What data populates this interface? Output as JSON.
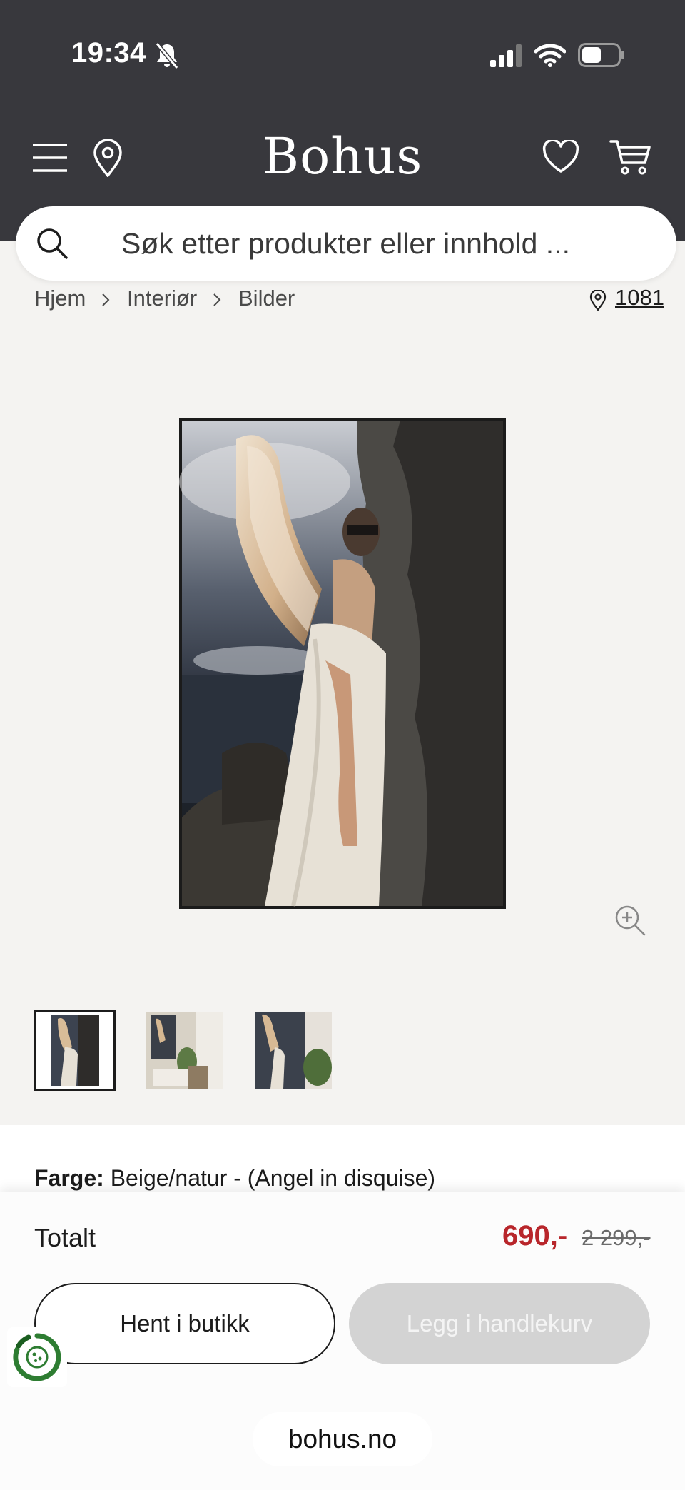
{
  "status_bar": {
    "time": "19:34"
  },
  "header": {
    "logo": "Bohus"
  },
  "search": {
    "placeholder": "Søk etter produkter eller innhold ..."
  },
  "breadcrumb": {
    "items": [
      "Hjem",
      "Interiør",
      "Bilder"
    ],
    "store_code": "1081"
  },
  "product": {
    "color_label": "Farge:",
    "color_value": "Beige/natur - (Angel in disquise)"
  },
  "purchase": {
    "total_label": "Totalt",
    "price": "690,-",
    "old_price": "2 299,-",
    "pickup_button": "Hent i butikk",
    "add_to_cart_button": "Legg i handlekurv"
  },
  "browser": {
    "url": "bohus.no"
  },
  "colors": {
    "header_bg": "#38383d",
    "price_red": "#b8262b",
    "page_bg": "#f4f3f1"
  }
}
